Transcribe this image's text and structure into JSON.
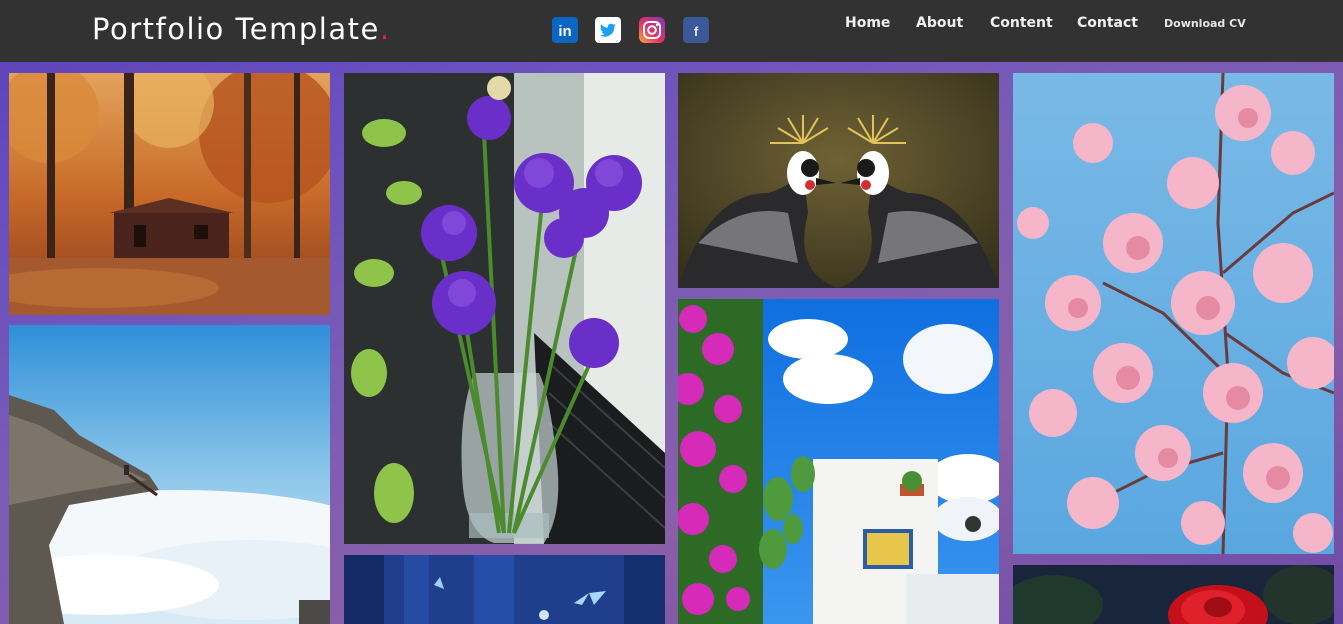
{
  "nav": {
    "brand": "Portfolio Template",
    "brand_dot": ".",
    "social": [
      {
        "icon": "linkedin-icon",
        "glyph": "in"
      },
      {
        "icon": "twitter-icon",
        "glyph": ""
      },
      {
        "icon": "instagram-icon",
        "glyph": ""
      },
      {
        "icon": "facebook-icon",
        "glyph": "f"
      }
    ],
    "links": [
      "Home",
      "About",
      "Content",
      "Contact",
      "Download CV"
    ]
  },
  "colors": {
    "navbar": "#323232",
    "brand_dot": "#e0283a",
    "background": "#6a4fc0"
  },
  "gallery": [
    {
      "subject": "autumn-cabin"
    },
    {
      "subject": "cliff-above-clouds"
    },
    {
      "subject": "purple-flowers-vase"
    },
    {
      "subject": "blue-butterflies"
    },
    {
      "subject": "crowned-cranes"
    },
    {
      "subject": "bougainvillea-house"
    },
    {
      "subject": "cherry-blossoms"
    },
    {
      "subject": "red-rose"
    }
  ]
}
